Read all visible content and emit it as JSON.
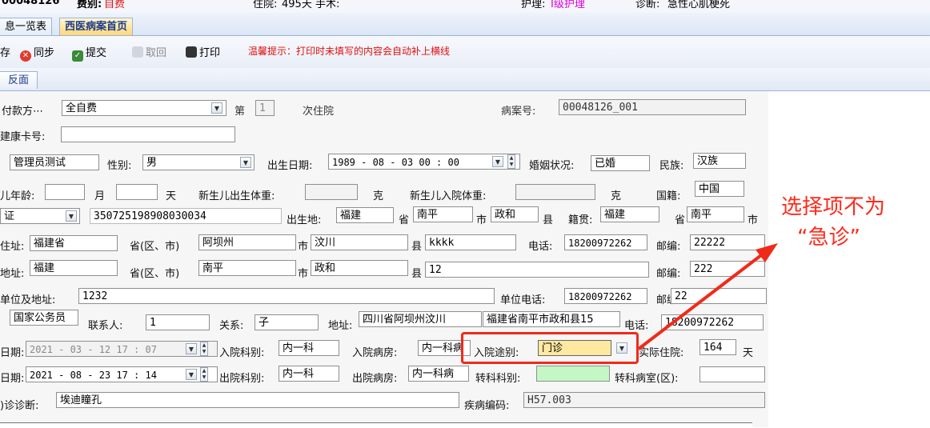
{
  "header": {
    "patient_id": "00048126",
    "fee_type_label": "费别:",
    "fee_type_value": "自费",
    "stay_label": "住院:",
    "stay_value": "495天 手术:",
    "nursing_label": "护理:",
    "nursing_value": "I级护理",
    "diagnosis_label": "诊断:",
    "diagnosis_value": "急性心肌梗死"
  },
  "tabs": [
    {
      "label": "息一览表"
    },
    {
      "label": "西医病案首页"
    }
  ],
  "toolbar": {
    "save_label": "存",
    "sync_label": "同步",
    "submit_label": "提交",
    "withdraw_label": "取回",
    "print_label": "打印",
    "tip": "温馨提示：打印时未填写的内容会自动补上横线"
  },
  "subtabs": [
    {
      "label": "反面"
    }
  ],
  "form": {
    "payment_label": "付款方⋯",
    "payment_value": "全自费",
    "admission_no_label": "第",
    "admission_no_value": "1",
    "admission_no_suffix": "次住院",
    "case_no_label": "病案号:",
    "case_no_value": "00048126_001",
    "health_card_label": "建康卡号:",
    "health_card_value": "",
    "name_value": "管理员测试",
    "gender_label": "性别:",
    "gender_value": "男",
    "birth_label": "出生日期:",
    "birth_value": "1989 - 08 - 03   00 : 00",
    "marital_label": "婚姻状况:",
    "marital_value": "已婚",
    "ethnic_label": "民族:",
    "ethnic_value": "汉族",
    "infant_age_label": "儿年龄:",
    "infant_month_label": "月",
    "infant_day_label": "天",
    "newborn_birth_weight_label": "新生儿出生体重:",
    "newborn_birth_weight_unit": "克",
    "newborn_admit_weight_label": "新生儿入院体重:",
    "newborn_admit_weight_unit": "克",
    "nationality_label": "国籍:",
    "nationality_value": "中国",
    "id_type_value": "证",
    "id_number_value": "350725198908030034",
    "birthplace_label": "出生地:",
    "birthplace_province": "福建",
    "province_label": "省",
    "birthplace_city": "南平",
    "city_label": "市",
    "birthplace_county": "政和",
    "county_label": "县",
    "native_label": "籍贯:",
    "native_province": "福建",
    "native_city": "南平",
    "current_addr_label": "住址:",
    "current_addr_province": "福建省",
    "province_region_label": "省(区、市)",
    "current_addr_city": "阿坝州",
    "current_addr_county": "汶川",
    "current_addr_detail": "kkkk",
    "phone_label": "电话:",
    "phone_value": "18200972262",
    "zip_label": "邮编:",
    "current_zip": "22222",
    "household_addr_label": "地址:",
    "household_province": "福建",
    "household_city": "南平",
    "household_county": "政和",
    "household_detail": "12",
    "household_zip": "222",
    "work_addr_label": "单位及地址:",
    "work_addr_value": "1232",
    "work_phone_label": "单位电话:",
    "work_phone_value": "18200972262",
    "work_zip": "22",
    "occupation_value": "国家公务员",
    "contact_label": "联系人:",
    "contact_value": "1",
    "relation_label": "关系:",
    "relation_value": "子",
    "contact_addr_label": "地址:",
    "contact_addr_value": "四川省阿坝州汶川",
    "contact_addr2_value": "福建省南平市政和县15",
    "contact_phone_label": "电话:",
    "contact_phone_value": "18200972262",
    "admit_date_label": "日期:",
    "admit_date_value": "2021 - 03 - 12   17 : 07",
    "admit_dept_label": "入院科别:",
    "admit_dept_value": "内一科",
    "admit_ward_label": "入院病房:",
    "admit_ward_value": "内一科病",
    "admit_route_label": "入院途别:",
    "admit_route_value": "门诊",
    "actual_stay_label": "实际住院:",
    "actual_stay_value": "164",
    "actual_stay_unit": "天",
    "discharge_date_label": "日期:",
    "discharge_date_value": "2021 - 08 - 23   17 : 14",
    "discharge_dept_label": "出院科别:",
    "discharge_dept_value": "内一科",
    "discharge_ward_label": "出院病房:",
    "discharge_ward_value": "内一科病",
    "transfer_dept_label": "转科科别:",
    "transfer_dept_value": "",
    "transfer_room_label": "转科病室(区):",
    "transfer_room_value": "",
    "outpatient_diag_label": ")诊诊断:",
    "outpatient_diag_value": "埃迪瞳孔",
    "disease_code_label": "疾病编码:",
    "disease_code_value": "H57.003"
  },
  "annotation": {
    "text_line1": "选择项不为",
    "text_line2": "“急诊”",
    "color": "#ff2a1a"
  }
}
